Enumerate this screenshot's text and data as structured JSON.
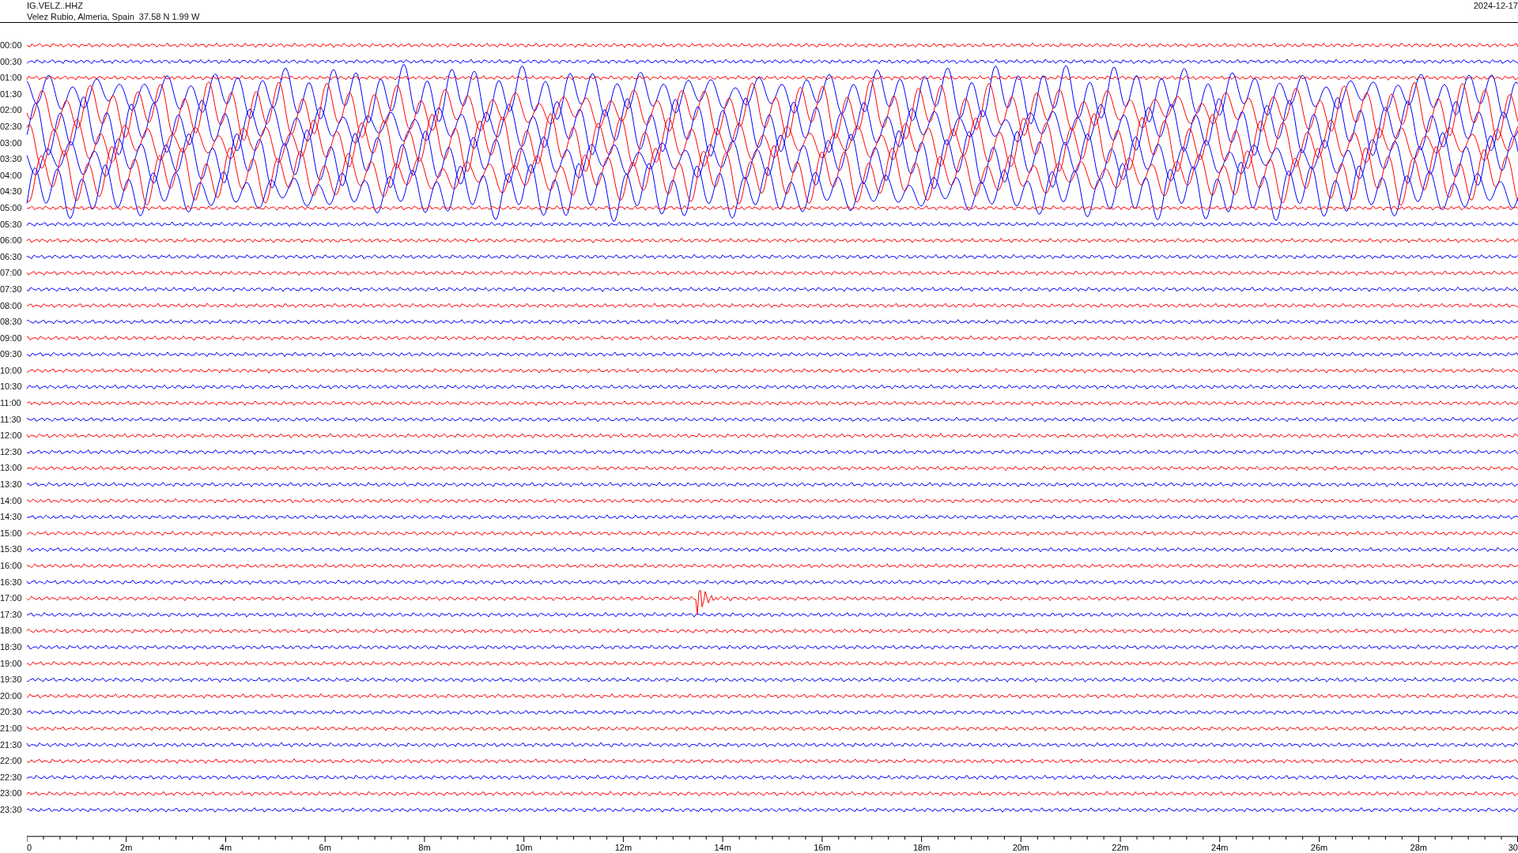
{
  "header": {
    "station": "IG.VELZ..HHZ",
    "location": "Velez Rubio, Almeria, Spain  37.58 N 1.99 W",
    "date": "2024-12-17"
  },
  "rows": [
    {
      "time": "00:00",
      "color": "#ff0000",
      "kind": "quiet"
    },
    {
      "time": "00:30",
      "color": "#0000ff",
      "kind": "quiet"
    },
    {
      "time": "01:00",
      "color": "#ff0000",
      "kind": "quiet"
    },
    {
      "time": "01:30",
      "color": "#0000ff",
      "kind": "strong"
    },
    {
      "time": "02:00",
      "color": "#ff0000",
      "kind": "strong"
    },
    {
      "time": "02:30",
      "color": "#0000ff",
      "kind": "strong"
    },
    {
      "time": "03:00",
      "color": "#ff0000",
      "kind": "strong"
    },
    {
      "time": "03:30",
      "color": "#0000ff",
      "kind": "strong"
    },
    {
      "time": "04:00",
      "color": "#ff0000",
      "kind": "strong"
    },
    {
      "time": "04:30",
      "color": "#0000ff",
      "kind": "strong"
    },
    {
      "time": "05:00",
      "color": "#ff0000",
      "kind": "quiet"
    },
    {
      "time": "05:30",
      "color": "#0000ff",
      "kind": "quiet"
    },
    {
      "time": "06:00",
      "color": "#ff0000",
      "kind": "quiet"
    },
    {
      "time": "06:30",
      "color": "#0000ff",
      "kind": "quiet"
    },
    {
      "time": "07:00",
      "color": "#ff0000",
      "kind": "quiet"
    },
    {
      "time": "07:30",
      "color": "#0000ff",
      "kind": "quiet"
    },
    {
      "time": "08:00",
      "color": "#ff0000",
      "kind": "quiet"
    },
    {
      "time": "08:30",
      "color": "#0000ff",
      "kind": "quiet"
    },
    {
      "time": "09:00",
      "color": "#ff0000",
      "kind": "quiet"
    },
    {
      "time": "09:30",
      "color": "#0000ff",
      "kind": "quiet"
    },
    {
      "time": "10:00",
      "color": "#ff0000",
      "kind": "quiet"
    },
    {
      "time": "10:30",
      "color": "#0000ff",
      "kind": "quiet"
    },
    {
      "time": "11:00",
      "color": "#ff0000",
      "kind": "quiet"
    },
    {
      "time": "11:30",
      "color": "#0000ff",
      "kind": "quiet"
    },
    {
      "time": "12:00",
      "color": "#ff0000",
      "kind": "quiet"
    },
    {
      "time": "12:30",
      "color": "#0000ff",
      "kind": "quiet"
    },
    {
      "time": "13:00",
      "color": "#ff0000",
      "kind": "quiet"
    },
    {
      "time": "13:30",
      "color": "#0000ff",
      "kind": "quiet"
    },
    {
      "time": "14:00",
      "color": "#ff0000",
      "kind": "quiet"
    },
    {
      "time": "14:30",
      "color": "#0000ff",
      "kind": "quiet"
    },
    {
      "time": "15:00",
      "color": "#ff0000",
      "kind": "quiet"
    },
    {
      "time": "15:30",
      "color": "#0000ff",
      "kind": "quiet"
    },
    {
      "time": "16:00",
      "color": "#ff0000",
      "kind": "quiet"
    },
    {
      "time": "16:30",
      "color": "#0000ff",
      "kind": "quiet"
    },
    {
      "time": "17:00",
      "color": "#ff0000",
      "kind": "spike"
    },
    {
      "time": "17:30",
      "color": "#0000ff",
      "kind": "quiet"
    },
    {
      "time": "18:00",
      "color": "#ff0000",
      "kind": "quiet"
    },
    {
      "time": "18:30",
      "color": "#0000ff",
      "kind": "quiet"
    },
    {
      "time": "19:00",
      "color": "#ff0000",
      "kind": "quiet"
    },
    {
      "time": "19:30",
      "color": "#0000ff",
      "kind": "quiet"
    },
    {
      "time": "20:00",
      "color": "#ff0000",
      "kind": "quiet"
    },
    {
      "time": "20:30",
      "color": "#0000ff",
      "kind": "quiet"
    },
    {
      "time": "21:00",
      "color": "#ff0000",
      "kind": "quiet"
    },
    {
      "time": "21:30",
      "color": "#0000ff",
      "kind": "quiet"
    },
    {
      "time": "22:00",
      "color": "#ff0000",
      "kind": "quiet"
    },
    {
      "time": "22:30",
      "color": "#0000ff",
      "kind": "quiet"
    },
    {
      "time": "23:00",
      "color": "#ff0000",
      "kind": "quiet"
    },
    {
      "time": "23:30",
      "color": "#0000ff",
      "kind": "quiet"
    }
  ],
  "axis": {
    "labels": [
      "0",
      "2m",
      "4m",
      "6m",
      "8m",
      "10m",
      "12m",
      "14m",
      "16m",
      "18m",
      "20m",
      "22m",
      "24m",
      "26m",
      "28m",
      "30"
    ]
  }
}
